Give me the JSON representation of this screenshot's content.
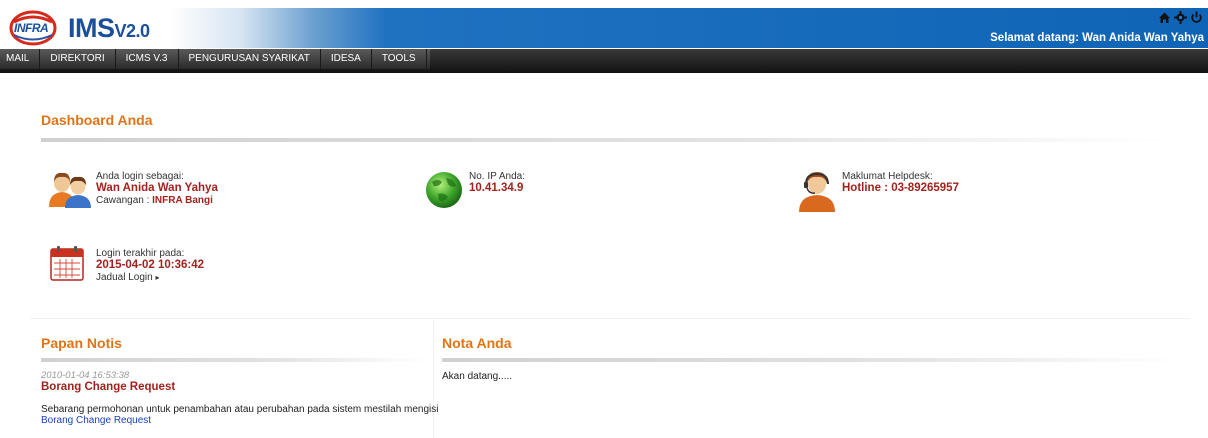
{
  "header": {
    "logo_badge": "INFRA",
    "logo_main": "IMS",
    "logo_version": "V2.0",
    "welcome": "Selamat datang: Wan Anida Wan Yahya",
    "icons": [
      "home-icon",
      "gear-icon",
      "power-icon"
    ]
  },
  "nav": {
    "items": [
      {
        "label": "MAIL"
      },
      {
        "label": "DIREKTORI"
      },
      {
        "label": "ICMS V.3"
      },
      {
        "label": "PENGURUSAN SYARIKAT"
      },
      {
        "label": "IDESA"
      },
      {
        "label": "TOOLS"
      }
    ]
  },
  "dashboard": {
    "title": "Dashboard Anda",
    "login_as": {
      "label": "Anda login sebagai:",
      "name": "Wan Anida Wan Yahya",
      "branch_label": "Cawangan : ",
      "branch": "INFRA Bangi"
    },
    "ip": {
      "label": "No. IP Anda:",
      "value": "10.41.34.9"
    },
    "helpdesk": {
      "label": "Maklumat Helpdesk:",
      "value": "Hotline : 03-89265957"
    },
    "last_login": {
      "label": "Login terakhir pada:",
      "value": "2015-04-02 10:36:42",
      "link": "Jadual Login"
    }
  },
  "notice_board": {
    "title": "Papan Notis",
    "items": [
      {
        "date": "2010-01-04 16:53:38",
        "title": "Borang Change Request",
        "body": "Sebarang permohonan untuk penambahan atau perubahan pada sistem mestilah mengisi",
        "link": "Borang Change Request"
      }
    ]
  },
  "notes": {
    "title": "Nota Anda",
    "text": "Akan datang....."
  },
  "colors": {
    "header_blue": "#0f64b6",
    "accent_orange": "#e07418",
    "value_red": "#a2231d",
    "link_blue": "#1a3fc0"
  }
}
